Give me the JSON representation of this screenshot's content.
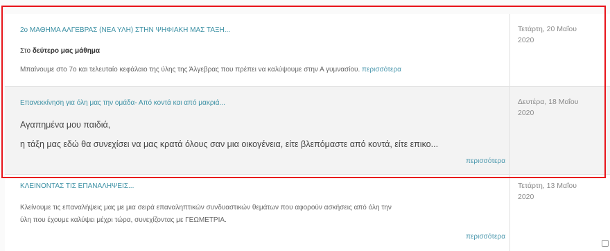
{
  "posts": [
    {
      "title": "2ο ΜΑΘΗΜΑ ΑΛΓΕΒΡΑΣ (ΝΕΑ ΥΛΗ) ΣΤΗΝ ΨΗΦΙΑΚΗ ΜΑΣ ΤΑΞΗ...",
      "line1_prefix": "Στο ",
      "line1_bold": "δεύτερο μας μάθημα",
      "line2": "Μπαίνουμε στο 7ο και τελευταίο κεφάλαιο της ύλης της Άλγεβρας που πρέπει να καλύψουμε στην Α γυμνασίου.",
      "more": "περισσότερα",
      "date_line1": "Τετάρτη, 20 Μαΐου",
      "date_line2": "2020"
    },
    {
      "title": "Επανεκκίνηση για όλη μας την ομάδα- Από κοντά και από μακριά...",
      "line1": "Αγαπημένα μου παιδιά,",
      "line2": "η τάξη μας εδώ θα συνεχίσει να μας κρατά όλους σαν μια οικογένεια, είτε βλεπόμαστε από κοντά, είτε επικο...",
      "more": "περισσότερα",
      "date_line1": "Δευτέρα, 18 Μαΐου",
      "date_line2": "2020"
    },
    {
      "title": "ΚΛΕΙΝΟΝΤΑΣ ΤΙΣ ΕΠΑΝΑΛΗΨΕΙΣ...",
      "line1": "Κλείνουμε τις επαναλήψεις μας με  μια σειρά επαναληπτικών συνδυαστικών θεμάτων που αφορούν ασκήσεις από όλη την",
      "line2": "ύλη που έχουμε καλύψει μέχρι τώρα, συνεχίζοντας με ΓΕΩΜΕΤΡΙΑ.",
      "more": "περισσότερα",
      "date_line1": "Τετάρτη, 13 Μαΐου",
      "date_line2": "2020"
    }
  ],
  "colors": {
    "highlight_border": "#e8141a",
    "link": "#3a8fa3"
  }
}
